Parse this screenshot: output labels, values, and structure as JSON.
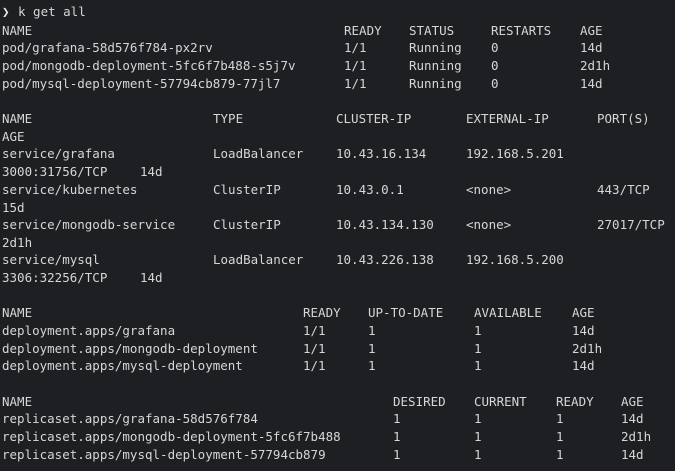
{
  "prompt": {
    "symbol": "❯",
    "command": "k get all"
  },
  "pods": {
    "headers": [
      "NAME",
      "READY",
      "STATUS",
      "RESTARTS",
      "AGE"
    ],
    "rows": [
      [
        "pod/grafana-58d576f784-px2rv",
        "1/1",
        "Running",
        "0",
        "14d"
      ],
      [
        "pod/mongodb-deployment-5fc6f7b488-s5j7v",
        "1/1",
        "Running",
        "0",
        "2d1h"
      ],
      [
        "pod/mysql-deployment-57794cb879-77jl7",
        "1/1",
        "Running",
        "0",
        "14d"
      ]
    ]
  },
  "services": {
    "headers": [
      "NAME",
      "TYPE",
      "CLUSTER-IP",
      "EXTERNAL-IP",
      "PORT(S)",
      "AGE"
    ],
    "rows": [
      [
        "service/grafana",
        "LoadBalancer",
        "10.43.16.134",
        "192.168.5.201",
        "3000:31756/TCP",
        "14d"
      ],
      [
        "service/kubernetes",
        "ClusterIP",
        "10.43.0.1",
        "<none>",
        "443/TCP",
        "15d"
      ],
      [
        "service/mongodb-service",
        "ClusterIP",
        "10.43.134.130",
        "<none>",
        "27017/TCP",
        "2d1h"
      ],
      [
        "service/mysql",
        "LoadBalancer",
        "10.43.226.138",
        "192.168.5.200",
        "3306:32256/TCP",
        "14d"
      ]
    ]
  },
  "deployments": {
    "headers": [
      "NAME",
      "READY",
      "UP-TO-DATE",
      "AVAILABLE",
      "AGE"
    ],
    "rows": [
      [
        "deployment.apps/grafana",
        "1/1",
        "1",
        "1",
        "14d"
      ],
      [
        "deployment.apps/mongodb-deployment",
        "1/1",
        "1",
        "1",
        "2d1h"
      ],
      [
        "deployment.apps/mysql-deployment",
        "1/1",
        "1",
        "1",
        "14d"
      ]
    ]
  },
  "replicasets": {
    "headers": [
      "NAME",
      "DESIRED",
      "CURRENT",
      "READY",
      "AGE"
    ],
    "rows": [
      [
        "replicaset.apps/grafana-58d576f784",
        "1",
        "1",
        "1",
        "14d"
      ],
      [
        "replicaset.apps/mongodb-deployment-5fc6f7b488",
        "1",
        "1",
        "1",
        "2d1h"
      ],
      [
        "replicaset.apps/mysql-deployment-57794cb879",
        "1",
        "1",
        "1",
        "14d"
      ]
    ]
  }
}
